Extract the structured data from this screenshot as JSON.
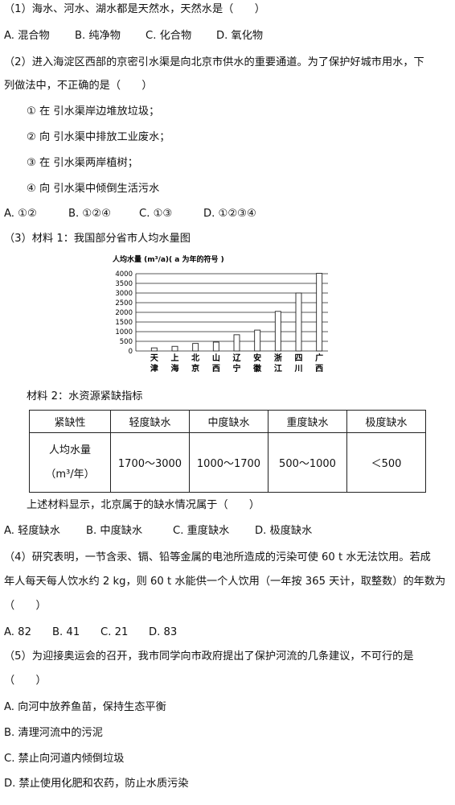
{
  "q1": {
    "stem": "（1）海水、河水、湖水都是天然水，天然水是（　　）",
    "options": [
      "A. 混合物",
      "B. 纯净物",
      "C. 化合物",
      "D. 氧化物"
    ]
  },
  "q2": {
    "stem_line1": "（2）进入海淀区西部的京密引水渠是向北京市供水的重要通道。为了保护好城市用水，下",
    "stem_line2": "列做法中，不正确的是（　　）",
    "items": [
      "① 在 引水渠岸边堆放垃圾；",
      "② 向 引水渠中排放工业废水；",
      "③ 在 引水渠两岸植树；",
      "④ 向 引水渠中倾倒生活污水"
    ],
    "options": [
      "A. ①②",
      "B. ①②④",
      "C. ①③",
      "D. ①②③④"
    ]
  },
  "q3": {
    "stem": "（3）材料 1：我国部分省市人均水量图",
    "material2": "材料 2：水资源紧缺指标",
    "conclusion": "上述材料显示，北京属于的缺水情况属于（　　）",
    "options": [
      "A. 轻度缺水",
      "B. 中度缺水",
      "C. 重度缺水",
      "D. 极度缺水"
    ],
    "table": {
      "headers": [
        "紧缺性",
        "轻度缺水",
        "中度缺水",
        "重度缺水",
        "极度缺水"
      ],
      "row_label_line1": "人均水量",
      "row_label_line2": "（m³/年）",
      "values": [
        "1700～3000",
        "1000～1700",
        "500～1000",
        "＜500"
      ]
    }
  },
  "chart_data": {
    "type": "bar",
    "title": "人均水量 (m³/a)( a 为年的符号 )",
    "categories": [
      [
        "天",
        "津"
      ],
      [
        "上",
        "海"
      ],
      [
        "北",
        "京"
      ],
      [
        "山",
        "西"
      ],
      [
        "辽",
        "宁"
      ],
      [
        "安",
        "徽"
      ],
      [
        "浙",
        "江"
      ],
      [
        "四",
        "川"
      ],
      [
        "广",
        "西"
      ]
    ],
    "values": [
      160,
      240,
      390,
      460,
      840,
      1080,
      2050,
      3000,
      4020
    ],
    "yticks": [
      0,
      500,
      1000,
      1500,
      2000,
      2500,
      3000,
      3500,
      4000
    ],
    "ylim": [
      0,
      4000
    ],
    "grid": true
  },
  "q4": {
    "stem_line1": "（4）研究表明，一节含汞、镉、铅等金属的电池所造成的污染可使 60 t 水无法饮用。若成",
    "stem_line2": "年人每天每人饮水约 2 kg，则 60 t 水能供一个人饮用（一年按 365 天计，取整数）的年数为",
    "stem_line3": "（　　）",
    "options": [
      "A. 82",
      "B. 41",
      "C. 21",
      "D. 83"
    ]
  },
  "q5": {
    "stem_line1": "（5）为迎接奥运会的召开，我市同学向市政府提出了保护河流的几条建议，不可行的是",
    "stem_line2": "（　　）",
    "options": [
      "A. 向河中放养鱼苗，保持生态平衡",
      "B. 清理河流中的污泥",
      "C. 禁止向河道内倾倒垃圾",
      "D. 禁止使用化肥和农药，防止水质污染"
    ]
  }
}
